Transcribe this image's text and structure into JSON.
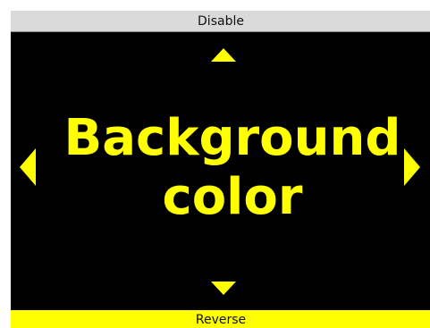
{
  "top_bar": {
    "label": "Disable"
  },
  "bottom_bar": {
    "label": "Reverse"
  },
  "main": {
    "line1": "Background",
    "line2": "color"
  },
  "icons": {
    "up": "arrow-up-icon",
    "down": "arrow-down-icon",
    "left": "arrow-left-icon",
    "right": "arrow-right-icon"
  },
  "colors": {
    "background": "#000000",
    "accent": "#ffff00",
    "top_bar": "#dadada",
    "bottom_bar": "#ffff00"
  }
}
